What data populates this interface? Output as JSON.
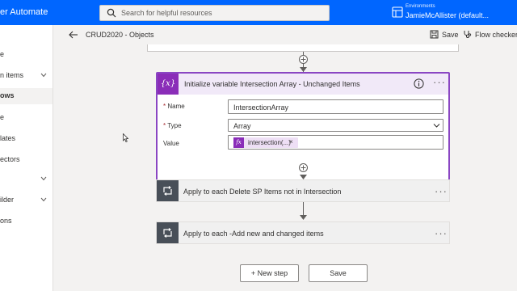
{
  "header": {
    "app_title": "er Automate",
    "search_placeholder": "Search for helpful resources",
    "env_label": "Environments",
    "env_user": "JamieMcAllister (default..."
  },
  "leftnav": {
    "items": [
      {
        "label": "e",
        "chevron": false,
        "active": false
      },
      {
        "label": "n items",
        "chevron": true,
        "active": false
      },
      {
        "label": "ows",
        "chevron": false,
        "active": true
      },
      {
        "label": "e",
        "chevron": false,
        "active": false
      },
      {
        "label": "lates",
        "chevron": false,
        "active": false
      },
      {
        "label": "ectors",
        "chevron": false,
        "active": false
      },
      {
        "label": "",
        "chevron": true,
        "active": false
      },
      {
        "label": "ilder",
        "chevron": true,
        "active": false
      },
      {
        "label": "ons",
        "chevron": false,
        "active": false
      }
    ]
  },
  "commandbar": {
    "flow_name": "CRUD2020 - Objects",
    "save_label": "Save",
    "flow_checker_label": "Flow checker"
  },
  "variable_card": {
    "icon_text": "{x}",
    "title": "Initialize variable Intersection Array - Unchanged Items",
    "more": "···",
    "name_label": "Name",
    "name_value": "IntersectionArray",
    "type_label": "Type",
    "type_value": "Array",
    "value_label": "Value",
    "required_mark": "*",
    "token_icon": "fx",
    "token_text": "intersection(...)",
    "token_remove": "×"
  },
  "actions": [
    {
      "title": "Apply to each Delete SP Items not in Intersection",
      "more": "···"
    },
    {
      "title": "Apply to each -Add new and changed items",
      "more": "···"
    }
  ],
  "footer": {
    "new_step_label": "+ New step",
    "save_label": "Save"
  },
  "colors": {
    "header_blue": "#0066ff",
    "variable_purple": "#8a2db8",
    "loop_gray": "#484f58"
  }
}
